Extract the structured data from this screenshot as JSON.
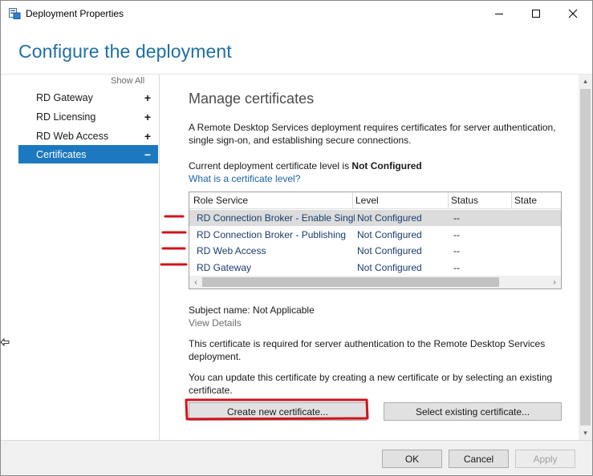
{
  "window": {
    "title": "Deployment Properties",
    "accent": "#1c79c0",
    "title_color": "#1e6fa7"
  },
  "header": {
    "title": "Configure the deployment"
  },
  "sidebar": {
    "show_all": "Show All",
    "items": [
      {
        "label": "RD Gateway",
        "sign": "+",
        "selected": false
      },
      {
        "label": "RD Licensing",
        "sign": "+",
        "selected": false
      },
      {
        "label": "RD Web Access",
        "sign": "+",
        "selected": false
      },
      {
        "label": "Certificates",
        "sign": "−",
        "selected": true
      }
    ]
  },
  "content": {
    "section_title": "Manage certificates",
    "intro_line1": "A Remote Desktop Services deployment requires certificates for server authentication,",
    "intro_line2": "single sign-on, and establishing secure connections.",
    "level_prefix": "Current deployment certificate level is ",
    "level_value": "Not Configured",
    "level_link": "What is a certificate level?",
    "table": {
      "columns": [
        "Role Service",
        "Level",
        "Status",
        "State"
      ],
      "rows": [
        {
          "role": "RD Connection Broker - Enable Single Sign On",
          "level": "Not Configured",
          "status": "--",
          "selected": true
        },
        {
          "role": "RD Connection Broker - Publishing",
          "level": "Not Configured",
          "status": "--",
          "selected": false
        },
        {
          "role": "RD Web Access",
          "level": "Not Configured",
          "status": "--",
          "selected": false
        },
        {
          "role": "RD Gateway",
          "level": "Not Configured",
          "status": "--",
          "selected": false
        }
      ]
    },
    "subject_name": "Subject name: Not Applicable",
    "view_details": "View Details",
    "required_line1": "This certificate is required for server authentication to the Remote Desktop Services",
    "required_line2": "deployment.",
    "update_line1": "You can update this certificate by creating a new certificate or by selecting an existing",
    "update_line2": "certificate.",
    "create_button": "Create new certificate...",
    "select_button": "Select existing certificate..."
  },
  "footer": {
    "ok": "OK",
    "cancel": "Cancel",
    "apply": "Apply"
  },
  "annotation_color": "#d0141c"
}
